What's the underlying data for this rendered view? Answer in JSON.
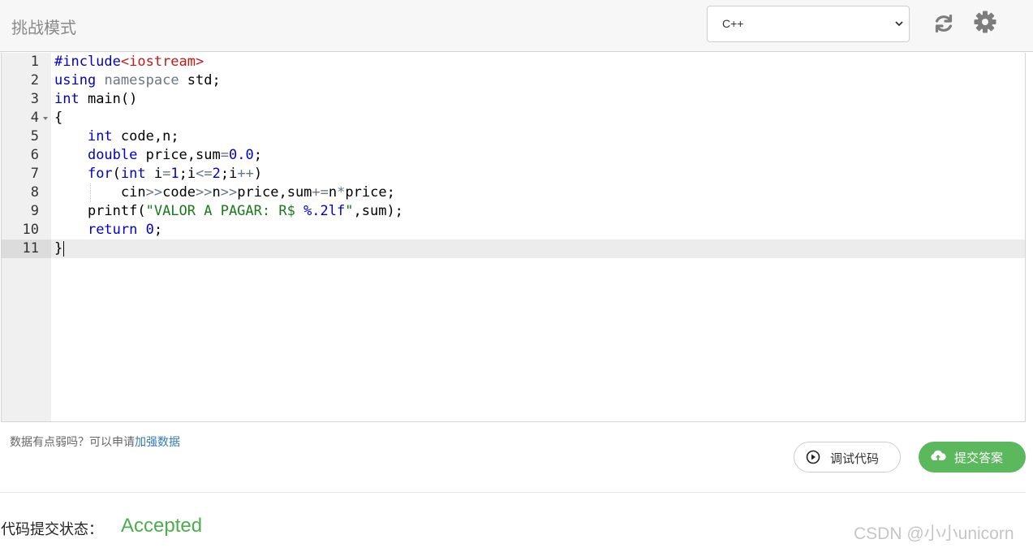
{
  "header": {
    "title": "挑战模式",
    "language": {
      "selected": "C++"
    },
    "icons": [
      "refresh-icon",
      "gear-icon"
    ]
  },
  "editor": {
    "line_numbers": [
      "1",
      "2",
      "3",
      "4",
      "5",
      "6",
      "7",
      "8",
      "9",
      "10",
      "11"
    ],
    "lines": [
      "#include<iostream>",
      "using namespace std;",
      "int main()",
      "{",
      "    int code,n;",
      "    double price,sum=0.0;",
      "    for(int i=1;i<=2;i++)",
      "        cin>>code>>n>>price,sum+=n*price;",
      "    printf(\"VALOR A PAGAR: R$ %.2lf\",sum);",
      "    return 0;",
      "}"
    ],
    "active_line": 11
  },
  "footer": {
    "weak_data_text": "数据有点弱吗？可以申请",
    "weak_data_link": "加强数据",
    "debug_label": "调试代码",
    "submit_label": "提交答案",
    "status_label": "代码提交状态：",
    "status_value": "Accepted",
    "watermark": "CSDN @小小unicorn"
  },
  "colors": {
    "accent_green": "#5cb85c",
    "accepted_green": "#4cae4c",
    "link_blue": "#337ab7"
  }
}
